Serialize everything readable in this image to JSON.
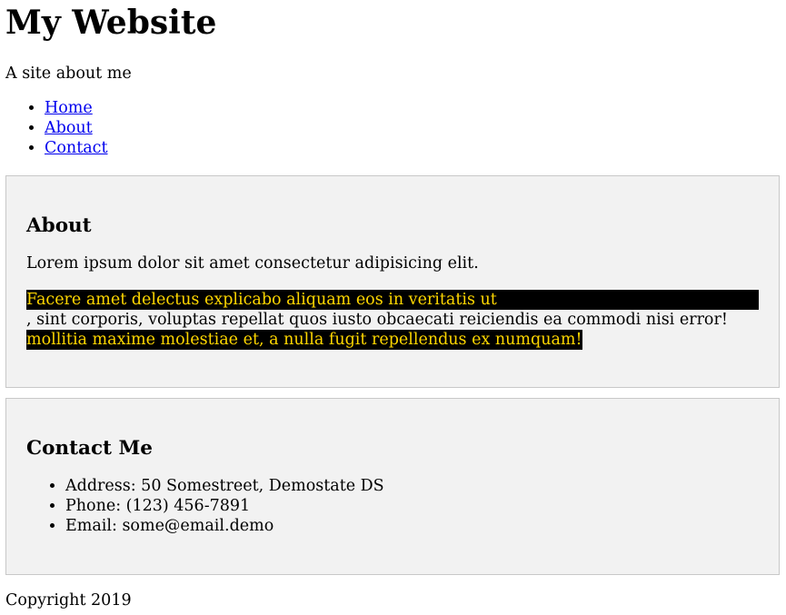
{
  "header": {
    "title": "My Website",
    "tagline": "A site about me"
  },
  "nav": {
    "items": [
      {
        "label": "Home"
      },
      {
        "label": "About"
      },
      {
        "label": "Contact"
      }
    ]
  },
  "about": {
    "heading": "About",
    "paragraph1": "Lorem ipsum dolor sit amet consectetur adipisicing elit.",
    "highlight1": "Facere amet delectus explicabo aliquam eos in veritatis ut",
    "plain": ", sint corporis, voluptas repellat quos iusto obcaecati reiciendis ea commodi nisi error!",
    "highlight2": "mollitia maxime molestiae et, a nulla fugit repellendus ex numquam!",
    "highlight_colors": {
      "background": "#000000",
      "text": "#ffd700"
    }
  },
  "contact": {
    "heading": "Contact Me",
    "items": [
      {
        "text": "Address: 50 Somestreet, Demostate DS"
      },
      {
        "text": "Phone: (123) 456-7891"
      },
      {
        "text": "Email: some@email.demo"
      }
    ]
  },
  "footer": {
    "copyright": "Copyright 2019"
  }
}
